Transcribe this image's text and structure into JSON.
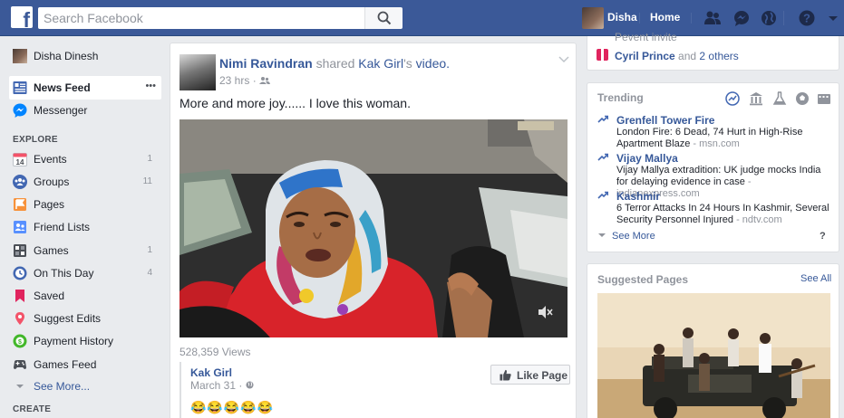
{
  "topbar": {
    "search_placeholder": "Search Facebook",
    "user_name": "Disha",
    "home_label": "Home",
    "icons": [
      "friend-requests-icon",
      "messenger-icon",
      "notifications-globe-icon",
      "help-icon",
      "account-menu-icon"
    ]
  },
  "leftnav": {
    "profile_name": "Disha Dinesh",
    "items": [
      {
        "label": "News Feed",
        "icon": "news-feed-icon"
      },
      {
        "label": "Messenger",
        "icon": "messenger-icon"
      }
    ],
    "explore_heading": "EXPLORE",
    "explore": [
      {
        "label": "Events",
        "count": "1",
        "icon": "calendar-icon"
      },
      {
        "label": "Groups",
        "count": "11",
        "icon": "groups-icon"
      },
      {
        "label": "Pages",
        "count": "",
        "icon": "flag-icon"
      },
      {
        "label": "Friend Lists",
        "count": "",
        "icon": "friend-list-icon"
      },
      {
        "label": "Games",
        "count": "1",
        "icon": "games-icon"
      },
      {
        "label": "On This Day",
        "count": "4",
        "icon": "clock-icon"
      },
      {
        "label": "Saved",
        "count": "",
        "icon": "bookmark-icon"
      },
      {
        "label": "Suggest Edits",
        "count": "",
        "icon": "map-pin-icon"
      },
      {
        "label": "Payment History",
        "count": "",
        "icon": "payment-icon"
      },
      {
        "label": "Games Feed",
        "count": "",
        "icon": "gamepad-icon"
      }
    ],
    "see_more": "See More...",
    "create_heading": "CREATE",
    "more_dots": "•••"
  },
  "post": {
    "author": "Nimi Ravindran",
    "shared_word": "shared",
    "shared_page": "Kak Girl",
    "possessive": "'s",
    "video_word": "video.",
    "time": "23 hrs",
    "time_sep": "·",
    "text": "More and more joy...... I love this woman.",
    "views": "528,359 Views",
    "shared_page_name": "Kak Girl",
    "shared_date": "March 31",
    "shared_date_sep": "·",
    "like_page_label": "Like Page",
    "emojis": "😂😂😂😂😂"
  },
  "right": {
    "faded_top": "Pevent invite",
    "birthday_name": "Cyril Prince",
    "birthday_and": "and",
    "birthday_others": "2 others",
    "trending_title": "Trending",
    "trending_categories": [
      "trending-icon",
      "politics-icon",
      "science-icon",
      "sports-icon",
      "entertainment-icon"
    ],
    "trending": [
      {
        "name": "Grenfell Tower Fire",
        "desc": "London Fire: 6 Dead, 74 Hurt in High-Rise Apartment Blaze",
        "source": "msn.com"
      },
      {
        "name": "Vijay Mallya",
        "desc": "Vijay Mallya extradition: UK judge mocks India for delaying evidence in case",
        "source": "indianexpress.com"
      },
      {
        "name": "Kashmir",
        "desc": "6 Terror Attacks In 24 Hours In Kashmir, Several Security Personnel Injured",
        "source": "ndtv.com"
      }
    ],
    "source_sep": " - ",
    "trending_see_more": "See More",
    "trending_help": "?",
    "suggested_title": "Suggested Pages",
    "suggested_see_all": "See All"
  },
  "colors": {
    "brand_blue": "#3b5998",
    "link_blue": "#365899",
    "background": "#e9ebee"
  }
}
